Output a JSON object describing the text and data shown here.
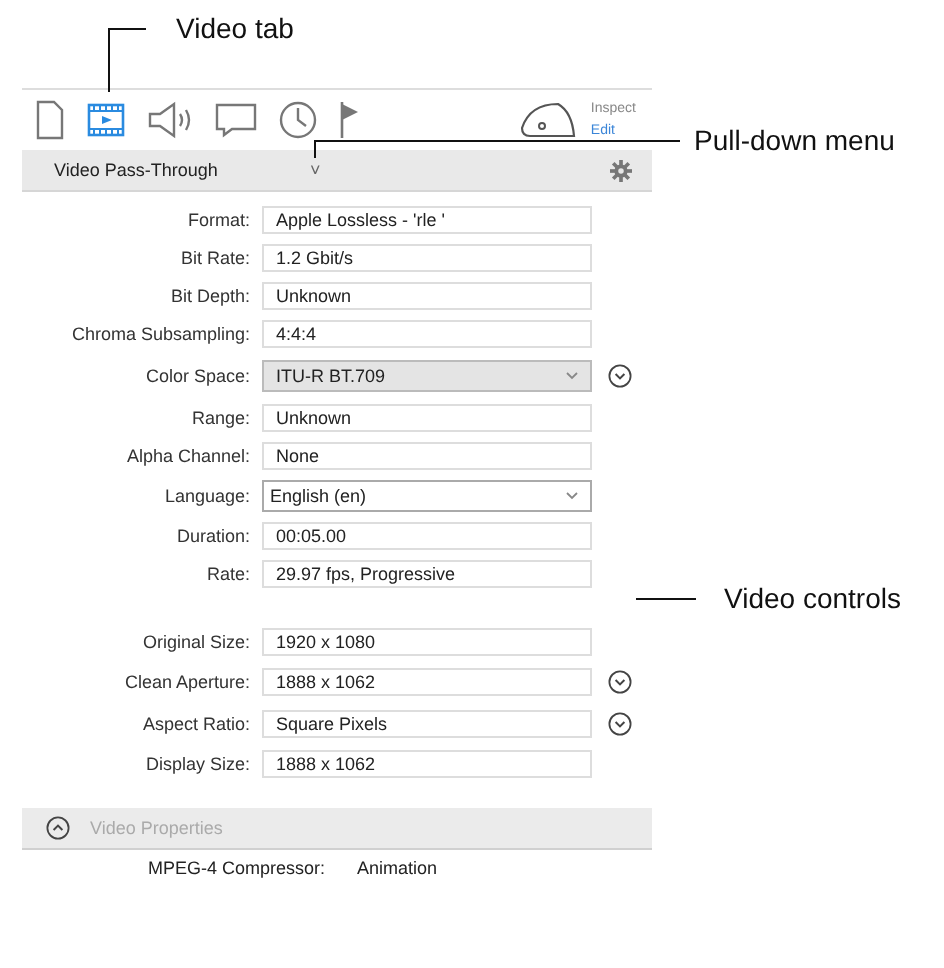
{
  "tabs": [
    {
      "kind": "document",
      "selected": false
    },
    {
      "kind": "video",
      "selected": true
    },
    {
      "kind": "audio",
      "selected": false
    },
    {
      "kind": "caption",
      "selected": false
    },
    {
      "kind": "timecode",
      "selected": false
    },
    {
      "kind": "marker",
      "selected": false
    }
  ],
  "inspect": {
    "label": "Inspect",
    "link": "Edit"
  },
  "header": {
    "title": "Video Pass-Through",
    "chevron": "˅"
  },
  "groups": [
    [
      {
        "label": "Format:",
        "value": "Apple Lossless - 'rle '",
        "kind": "field",
        "menu_button": false
      },
      {
        "label": "Bit Rate:",
        "value": "1.2 Gbit/s",
        "kind": "field",
        "menu_button": false
      },
      {
        "label": "Bit Depth:",
        "value": "Unknown",
        "kind": "field",
        "menu_button": false
      },
      {
        "label": "Chroma Subsampling:",
        "value": "4:4:4",
        "kind": "field",
        "menu_button": false
      },
      {
        "label": "Color Space:",
        "value": "ITU-R BT.709",
        "kind": "popup",
        "menu_button": true
      },
      {
        "label": "Range:",
        "value": "Unknown",
        "kind": "field",
        "menu_button": false
      },
      {
        "label": "Alpha Channel:",
        "value": "None",
        "kind": "field",
        "menu_button": false
      },
      {
        "label": "Language:",
        "value": "English (en)",
        "kind": "dropdown",
        "menu_button": false
      },
      {
        "label": "Duration:",
        "value": "00:05.00",
        "kind": "field",
        "menu_button": false
      },
      {
        "label": "Rate:",
        "value": "29.97 fps, Progressive",
        "kind": "field",
        "menu_button": false
      }
    ],
    [
      {
        "label": "Original Size:",
        "value": "1920 x 1080",
        "kind": "field",
        "menu_button": false
      },
      {
        "label": "Clean Aperture:",
        "value": "1888 x 1062",
        "kind": "field",
        "menu_button": true
      },
      {
        "label": "Aspect Ratio:",
        "value": "Square Pixels",
        "kind": "field",
        "menu_button": true
      },
      {
        "label": "Display Size:",
        "value": "1888 x 1062",
        "kind": "field",
        "menu_button": false
      }
    ]
  ],
  "section": {
    "title": "Video Properties",
    "expanded": true
  },
  "properties": [
    {
      "label": "MPEG-4 Compressor:",
      "value": "Animation"
    }
  ],
  "callouts": [
    {
      "text": "Video tab"
    },
    {
      "text": "Pull-down menu"
    },
    {
      "text": "Video controls"
    }
  ]
}
